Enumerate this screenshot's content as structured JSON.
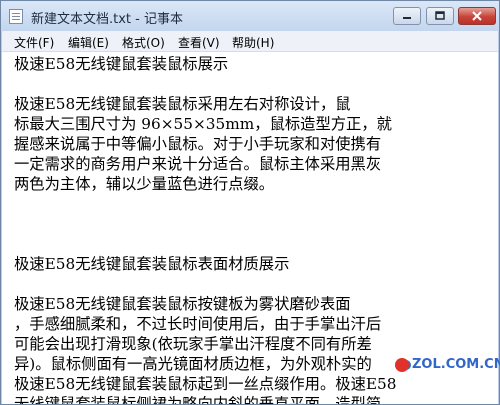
{
  "window": {
    "title": "新建文本文档.txt - 记事本",
    "controls": [
      "minimize",
      "maximize",
      "close"
    ]
  },
  "menu": {
    "items": [
      {
        "label": "文件(F)"
      },
      {
        "label": "编辑(E)"
      },
      {
        "label": "格式(O)"
      },
      {
        "label": "查看(V)"
      },
      {
        "label": "帮助(H)"
      }
    ]
  },
  "document": {
    "lines": [
      "极速E58无线键鼠套装鼠标展示",
      "",
      "    极速E58无线键鼠套装鼠标采用左右对称设计，鼠",
      "标最大三围尺寸为 96×55×35mm，鼠标造型方正，就",
      "握感来说属于中等偏小鼠标。对于小手玩家和对使携有",
      "一定需求的商务用户来说十分适合。鼠标主体采用黑灰",
      "两色为主体，辅以少量蓝色进行点缀。",
      "",
      "",
      "",
      "极速E58无线键鼠套装鼠标表面材质展示",
      "",
      "    极速E58无线键鼠套装鼠标按键板为雾状磨砂表面",
      "，手感细腻柔和，不过长时间使用后，由于手掌出汗后",
      "可能会出现打滑现象(依玩家手掌出汗程度不同有所差",
      "异)。鼠标侧面有一高光镜面材质边框，为外观朴实的",
      "极速E58无线键鼠套装鼠标起到一丝点缀作用。极速E58",
      "无线键鼠套装鼠标侧裙为略向内斜的垂直平面，造型简"
    ]
  },
  "watermark": {
    "text": "ZOL.COM.CN"
  },
  "colors": {
    "title_bar": "#c3d6ee",
    "close_button": "#c8433a",
    "menu_bar": "#eef2f8",
    "watermark": "#3266c8"
  }
}
